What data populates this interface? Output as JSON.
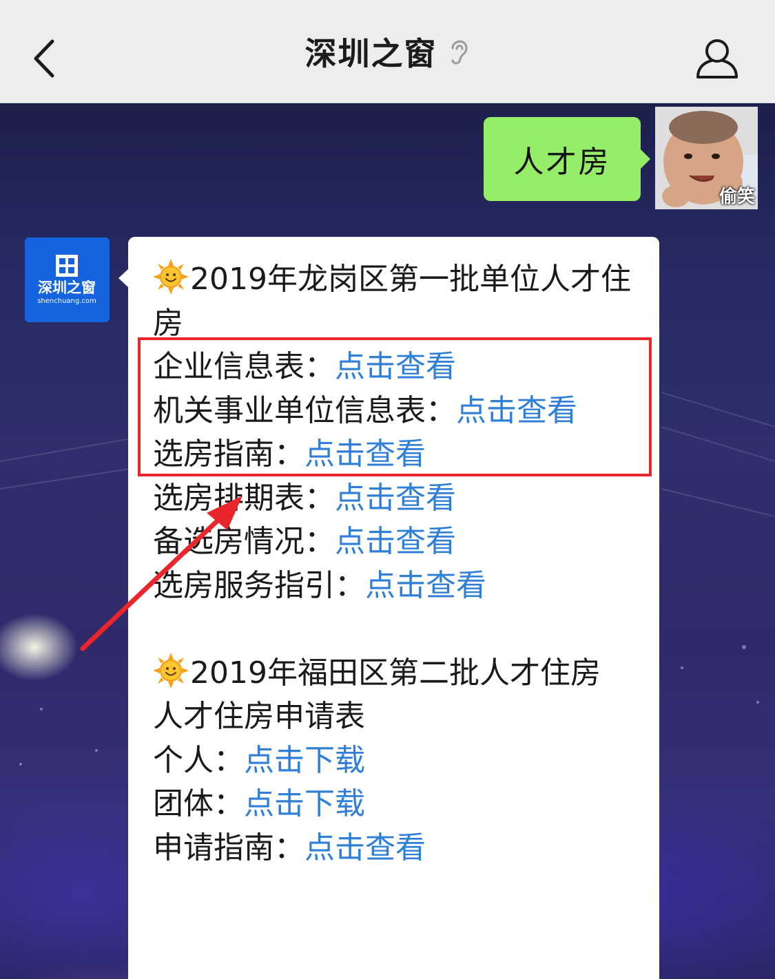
{
  "header": {
    "title": "深圳之窗",
    "back_icon": "chevron-left-icon",
    "ear_icon": "ear-icon",
    "profile_icon": "person-icon"
  },
  "outgoing": {
    "text": "人才房",
    "avatar_caption": "偷笑",
    "bubble_color": "#95ec69"
  },
  "incoming": {
    "avatar_logo_text": "深圳之窗",
    "avatar_logo_sub": "shenchuang.com",
    "avatar_color": "#1663df",
    "link_color": "#2f7fd8",
    "section1": {
      "icon": "sun-emoji-icon",
      "title": "2019年龙岗区第一批单位人才住房",
      "rows": [
        {
          "label": "企业信息表：",
          "link": "点击查看"
        },
        {
          "label": "机关事业单位信息表：",
          "link": "点击查看"
        },
        {
          "label": "选房指南：",
          "link": "点击查看"
        },
        {
          "label": "选房排期表：",
          "link": "点击查看"
        },
        {
          "label": "备选房情况：",
          "link": "点击查看"
        },
        {
          "label": "选房服务指引：",
          "link": "点击查看"
        }
      ]
    },
    "section2": {
      "icon": "sun-emoji-icon",
      "title": "2019年福田区第二批人才住房",
      "subtitle": "人才住房申请表",
      "rows": [
        {
          "label": "个人：",
          "link": "点击下载"
        },
        {
          "label": "团体：",
          "link": "点击下载"
        },
        {
          "label": "申请指南：",
          "link": "点击查看"
        }
      ]
    }
  },
  "annotation": {
    "color": "#e8262b"
  }
}
